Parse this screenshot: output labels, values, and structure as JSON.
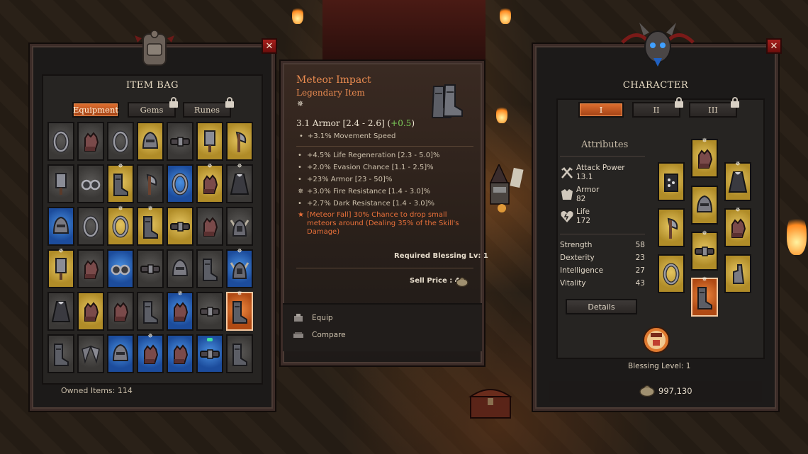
{
  "item_bag": {
    "title": "ITEM BAG",
    "close_label": "✕",
    "tabs": [
      "Equipment",
      "Gems",
      "Runes"
    ],
    "owned_items": "Owned Items: 114",
    "rows": [
      [
        {
          "c": "gray",
          "i": "ring-icon"
        },
        {
          "c": "gray",
          "i": "gloves-icon"
        },
        {
          "c": "gray",
          "i": "ring-icon"
        },
        {
          "c": "gold",
          "i": "helmet-icon"
        },
        {
          "c": "gray",
          "i": "belt-icon"
        },
        {
          "c": "gold",
          "i": "cleaver-icon"
        },
        {
          "c": "gold",
          "i": "axe-icon"
        }
      ],
      [
        {
          "c": "gray",
          "i": "cleaver-icon"
        },
        {
          "c": "gray",
          "i": "goggles-icon"
        },
        {
          "c": "gold",
          "i": "boots-icon",
          "s": true
        },
        {
          "c": "gray",
          "i": "axe-icon"
        },
        {
          "c": "blue",
          "i": "ring-icon"
        },
        {
          "c": "gold",
          "i": "gloves-icon",
          "s": true
        },
        {
          "c": "gray",
          "i": "cloak-icon",
          "s": true
        }
      ],
      [
        {
          "c": "blue",
          "i": "helmet-icon"
        },
        {
          "c": "gray",
          "i": "ring-icon"
        },
        {
          "c": "gold",
          "i": "ring-icon",
          "s": true
        },
        {
          "c": "gold",
          "i": "boots-icon",
          "s": true
        },
        {
          "c": "gold",
          "i": "belt-icon"
        },
        {
          "c": "gray",
          "i": "gloves-icon"
        },
        {
          "c": "gray",
          "i": "horned-helmet-icon"
        }
      ],
      [
        {
          "c": "gold",
          "i": "cleaver-icon",
          "s": true
        },
        {
          "c": "gray",
          "i": "gloves-icon"
        },
        {
          "c": "blue",
          "i": "goggles-icon"
        },
        {
          "c": "gray",
          "i": "belt-icon"
        },
        {
          "c": "gray",
          "i": "helmet-icon"
        },
        {
          "c": "gray",
          "i": "boots-icon"
        },
        {
          "c": "blue",
          "i": "horned-helmet-icon",
          "s": true
        }
      ],
      [
        {
          "c": "gray",
          "i": "cloak-icon"
        },
        {
          "c": "gold",
          "i": "gloves-icon"
        },
        {
          "c": "gray",
          "i": "gloves-icon"
        },
        {
          "c": "gray",
          "i": "boots-icon"
        },
        {
          "c": "blue",
          "i": "gloves-icon",
          "s": true
        },
        {
          "c": "gray",
          "i": "belt-icon"
        },
        {
          "c": "orange",
          "i": "boots-icon",
          "s": true
        }
      ],
      [
        {
          "c": "gray",
          "i": "boots-icon"
        },
        {
          "c": "gray",
          "i": "wings-icon"
        },
        {
          "c": "blue",
          "i": "helmet-icon"
        },
        {
          "c": "blue",
          "i": "gloves-icon",
          "s": true
        },
        {
          "c": "blue",
          "i": "gloves-icon"
        },
        {
          "c": "blue",
          "i": "belt-icon",
          "g": true
        },
        {
          "c": "gray",
          "i": "boots-icon"
        }
      ]
    ]
  },
  "tooltip": {
    "name": "Meteor Impact",
    "rarity": "Legendary Item",
    "star": "✵",
    "main_stat": "3.1 Armor [2.4 - 2.6] (",
    "main_bonus": "+0.5",
    "main_close": ")",
    "base_stats": [
      "+3.1% Movement Speed"
    ],
    "extra_stats": [
      {
        "bullet": "•",
        "text": "+4.5% Life Regeneration [2.3 - 5.0]%"
      },
      {
        "bullet": "•",
        "text": "+2.0% Evasion Chance [1.1 - 2.5]%"
      },
      {
        "bullet": "•",
        "text": "+23% Armor [23 - 50]%"
      },
      {
        "bullet": "✵",
        "text": "+3.0% Fire Resistance [1.4 - 3.0]%"
      },
      {
        "bullet": "•",
        "text": "+2.7% Dark Resistance [1.4 - 3.0]%"
      }
    ],
    "legendary_bullet": "★",
    "legendary_text": "[Meteor Fall] 30% Chance to drop small meteors around (Dealing 35% of the Skill's Damage)",
    "required": "Required Blessing Lv: 1",
    "sell_price": "Sell Price : 48",
    "actions": [
      "Equip",
      "Compare"
    ]
  },
  "character": {
    "title": "CHARACTER",
    "close_label": "✕",
    "tabs": [
      "I",
      "II",
      "III"
    ],
    "attributes_heading": "Attributes",
    "attack_label": "Attack Power",
    "attack_value": "13.1",
    "armor_label": "Armor",
    "armor_value": "82",
    "life_label": "Life",
    "life_value": "172",
    "stats": [
      {
        "label": "Strength",
        "value": "58"
      },
      {
        "label": "Dexterity",
        "value": "23"
      },
      {
        "label": "Intelligence",
        "value": "27"
      },
      {
        "label": "Vitality",
        "value": "43"
      }
    ],
    "details_label": "Details",
    "blessing_level": "Blessing Level: 1",
    "gold": "997,130"
  }
}
